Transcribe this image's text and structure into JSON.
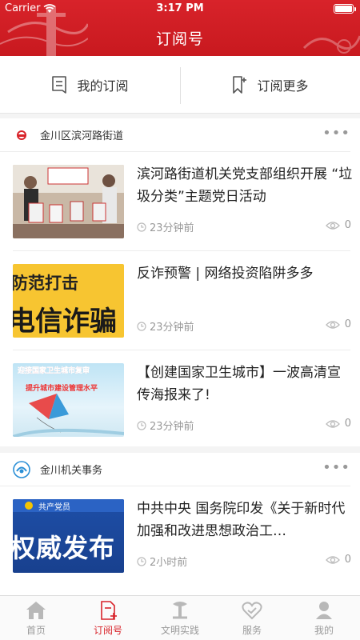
{
  "status_bar": {
    "carrier": "Carrier",
    "time": "3:17 PM"
  },
  "header": {
    "title": "订阅号"
  },
  "segments": {
    "my_subs": "我的订阅",
    "more_subs": "订阅更多"
  },
  "groups": [
    {
      "name": "金川区滨河路街道",
      "more": "•••",
      "articles": [
        {
          "title": "滨河路街道机关党支部组织开展 “垃圾分类”主题党日活动",
          "ago": "23分钟前",
          "views": "0"
        },
        {
          "title": "反诈预警 | 网络投资陷阱多多",
          "ago": "23分钟前",
          "views": "0"
        },
        {
          "title": "【创建国家卫生城市】一波高清宣传海报来了!",
          "ago": "23分钟前",
          "views": "0"
        }
      ]
    },
    {
      "name": "金川机关事务",
      "more": "•••",
      "articles": [
        {
          "title": "中共中央 国务院印发《关于新时代加强和改进思想政治工…",
          "ago": "2小时前",
          "views": "0"
        }
      ]
    }
  ],
  "thumb_text": {
    "a2_line1": "防范打击",
    "a2_line2": "电信诈骗",
    "a3_line1": "迎接国家卫生城市复审",
    "a3_line2": "提升城市建设管理水平",
    "a4_tag": "共产党员",
    "a4_big": "权威发布"
  },
  "tabbar": {
    "tabs": [
      {
        "label": "首页",
        "icon": "home-icon",
        "active": false
      },
      {
        "label": "订阅号",
        "icon": "subscribe-icon",
        "active": true
      },
      {
        "label": "文明实践",
        "icon": "practice-icon",
        "active": false
      },
      {
        "label": "服务",
        "icon": "service-icon",
        "active": false
      },
      {
        "label": "我的",
        "icon": "profile-icon",
        "active": false
      }
    ]
  },
  "colors": {
    "brand_red": "#d8232a",
    "muted": "#999999"
  }
}
